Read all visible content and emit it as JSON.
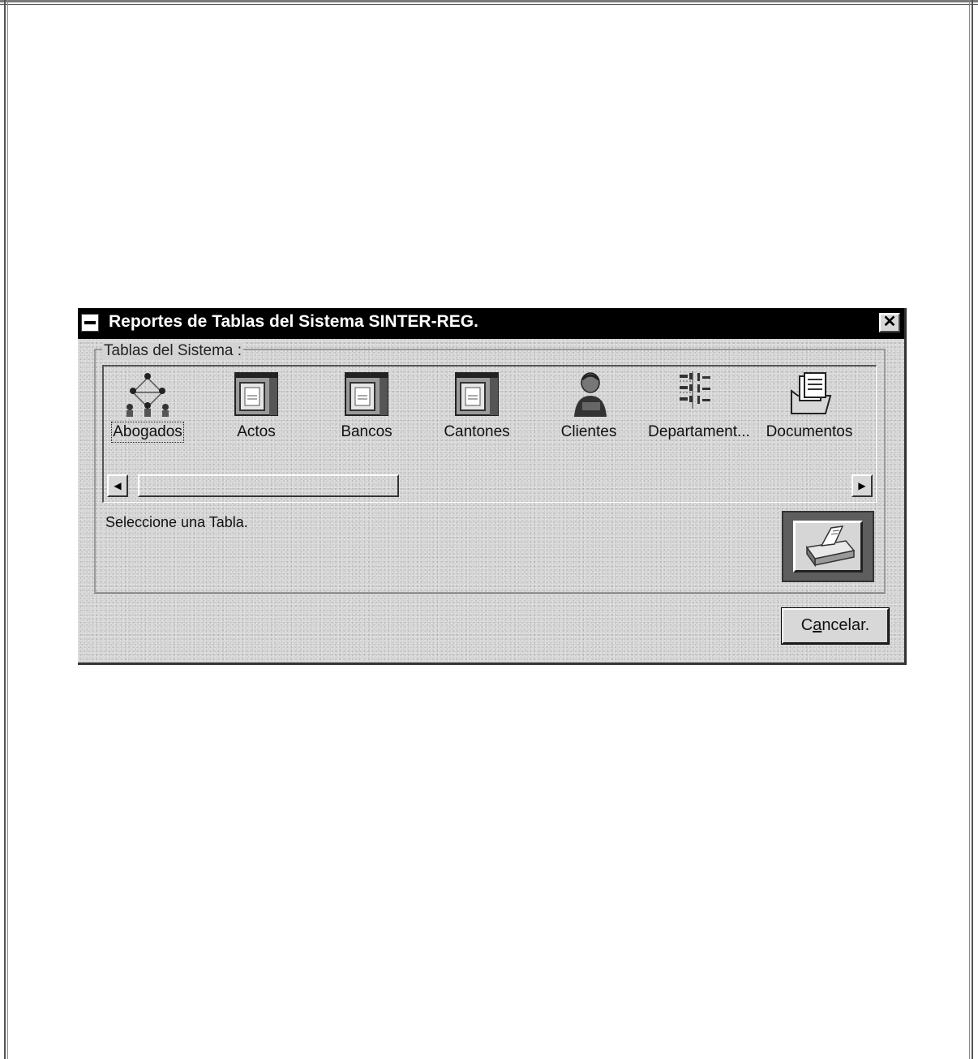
{
  "dialog": {
    "title": "Reportes de Tablas del Sistema SINTER-REG.",
    "close_label": "✕",
    "group_title": "Tablas del Sistema :",
    "status_text": "Seleccione una Tabla.",
    "cancel_label_prefix": "C",
    "cancel_label_mnemonic": "a",
    "cancel_label_suffix": "ncelar."
  },
  "tables": {
    "items": [
      {
        "label": "Abogados",
        "icon": "people-network-icon",
        "focused": true
      },
      {
        "label": "Actos",
        "icon": "document-window-icon"
      },
      {
        "label": "Bancos",
        "icon": "document-window-icon"
      },
      {
        "label": "Cantones",
        "icon": "document-window-icon"
      },
      {
        "label": "Clientes",
        "icon": "person-icon"
      },
      {
        "label": "Departament...",
        "icon": "org-chart-icon"
      },
      {
        "label": "Documentos",
        "icon": "folder-documents-icon"
      }
    ]
  },
  "scrollbar": {
    "left_arrow": "◀",
    "right_arrow": "▶"
  },
  "colors": {
    "titlebar": "#000000",
    "dialog_face": "#d3d3d3",
    "print_frame": "#5e5e5e"
  }
}
